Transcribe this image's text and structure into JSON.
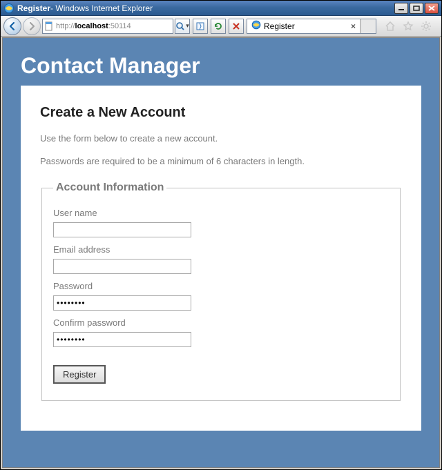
{
  "window": {
    "title_page": "Register",
    "title_app": " - Windows Internet Explorer"
  },
  "nav": {
    "url_prefix": "http://",
    "url_host": "localhost",
    "url_port": ":50114",
    "search_icon": "search-icon",
    "refresh_icon": "refresh-icon",
    "swap_icon": "swap-icon",
    "stop_icon": "stop-icon"
  },
  "tab": {
    "label": "Register"
  },
  "page": {
    "site_title": "Contact Manager",
    "heading": "Create a New Account",
    "intro": "Use the form below to create a new account.",
    "pw_rule": "Passwords are required to be a minimum of 6 characters in length.",
    "legend": "Account Information",
    "labels": {
      "username": "User name",
      "email": "Email address",
      "password": "Password",
      "confirm": "Confirm password"
    },
    "values": {
      "username": "",
      "email": "",
      "password": "••••••••",
      "confirm": "••••••••"
    },
    "register_btn": "Register"
  }
}
